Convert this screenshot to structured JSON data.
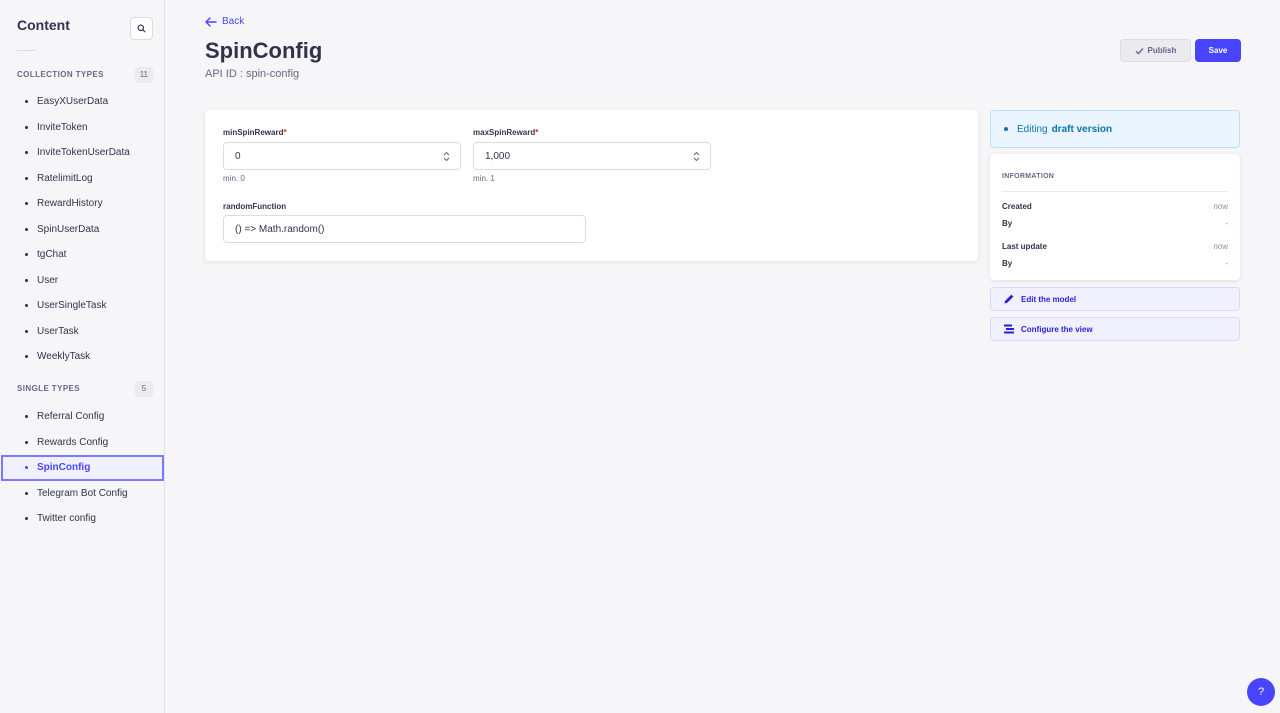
{
  "sidebar": {
    "title": "Content",
    "search_icon": "search-icon",
    "collection_types": {
      "label": "COLLECTION TYPES",
      "count": "11",
      "items": [
        "EasyXUserData",
        "InviteToken",
        "InviteTokenUserData",
        "RatelimitLog",
        "RewardHistory",
        "SpinUserData",
        "tgChat",
        "User",
        "UserSingleTask",
        "UserTask",
        "WeeklyTask"
      ]
    },
    "single_types": {
      "label": "SINGLE TYPES",
      "count": "5",
      "items": [
        "Referral Config",
        "Rewards Config",
        "SpinConfig",
        "Telegram Bot Config",
        "Twitter config"
      ],
      "active": "SpinConfig"
    }
  },
  "header": {
    "back_label": "Back",
    "title": "SpinConfig",
    "api_id": "API ID : spin-config",
    "publish_label": "Publish",
    "save_label": "Save"
  },
  "form": {
    "min_spin": {
      "label": "minSpinReward",
      "required": "*",
      "value": "0",
      "hint": "min. 0"
    },
    "max_spin": {
      "label": "maxSpinReward",
      "required": "*",
      "value": "1,000",
      "hint": "min. 1"
    },
    "random_fn": {
      "label": "randomFunction",
      "value": "() => Math.random()"
    }
  },
  "panel": {
    "draft_prefix": "Editing",
    "draft_strong": "draft version",
    "info_title": "INFORMATION",
    "rows": [
      {
        "key": "Created",
        "value": "now"
      },
      {
        "key": "By",
        "value": "-"
      },
      {
        "key": "Last update",
        "value": "now"
      },
      {
        "key": "By",
        "value": "-"
      }
    ],
    "edit_model": "Edit the model",
    "configure_view": "Configure the view"
  },
  "help": "?",
  "colors": {
    "accent": "#4945ff",
    "text": "#32324d",
    "muted": "#666687",
    "bg": "#f6f6f9"
  }
}
